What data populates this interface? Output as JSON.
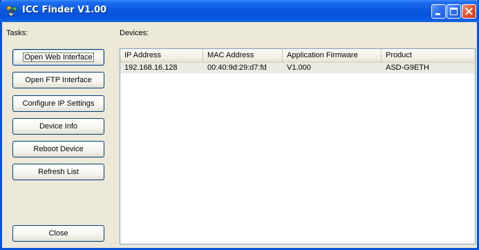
{
  "window": {
    "title": "ICC Finder V1.00",
    "icon": "network-icon"
  },
  "tasks": {
    "label": "Tasks:",
    "buttons": [
      {
        "label": "Open Web Interface"
      },
      {
        "label": "Open FTP Interface"
      },
      {
        "label": "Configure IP Settings"
      },
      {
        "label": "Device Info"
      },
      {
        "label": "Reboot Device"
      },
      {
        "label": "Refresh List"
      }
    ],
    "close_label": "Close"
  },
  "devices": {
    "label": "Devices:",
    "columns": [
      "IP Address",
      "MAC Address",
      "Application Firmware",
      "Product"
    ],
    "rows": [
      [
        "192.168.16.128",
        "00:40:9d:29:d7:fd",
        "V1.000",
        "ASD-G9ETH"
      ]
    ]
  },
  "colors": {
    "titlebar": "#0a58e0",
    "selected_row": "#ecebe2",
    "window_bg": "#ece9d8"
  }
}
